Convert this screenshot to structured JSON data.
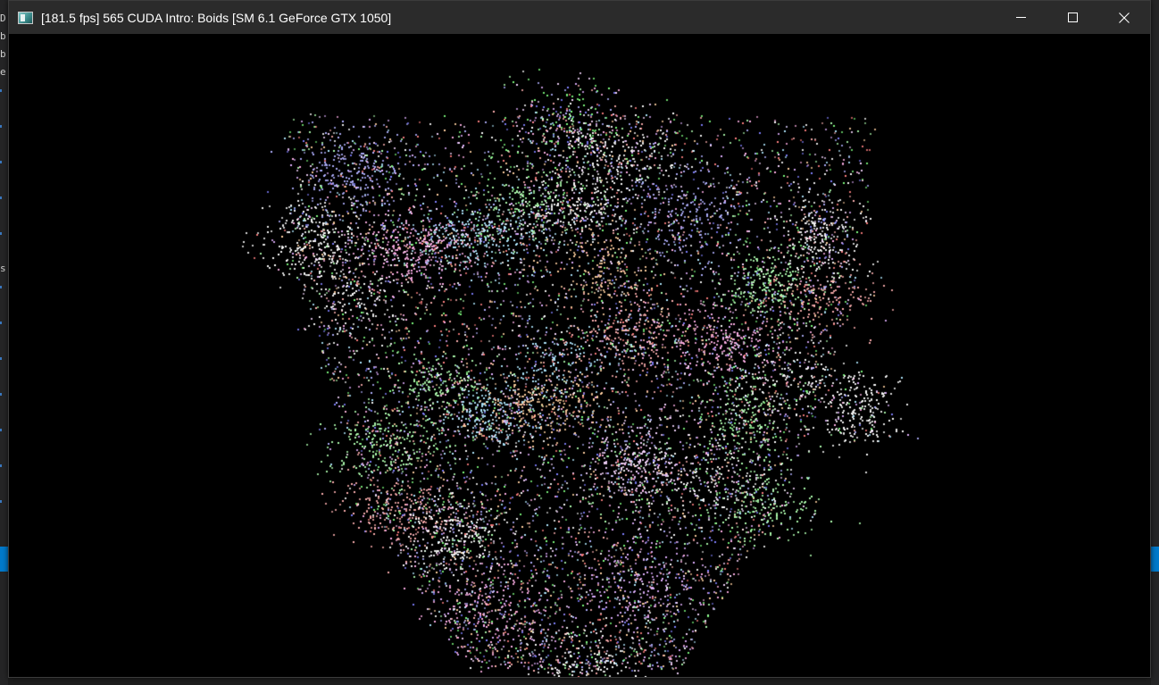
{
  "window": {
    "title": "[181.5 fps] 565 CUDA Intro: Boids [SM 6.1 GeForce GTX 1050]",
    "controls": {
      "minimize_icon": "minimize-icon",
      "maximize_icon": "maximize-icon",
      "close_icon": "close-icon"
    }
  },
  "background_edge": {
    "glyphs": [
      "D",
      "b",
      "b",
      "e",
      "s"
    ]
  },
  "simulation": {
    "palette": [
      "#ffffff",
      "#f6d6ff",
      "#ffb0e8",
      "#ffb0b0",
      "#b0ffb0",
      "#b0e8ff",
      "#b0b0ff",
      "#e0b0ff",
      "#ffd0a0",
      "#ff8080",
      "#80ff80",
      "#8080ff"
    ],
    "background": "#000000",
    "accent": "#007acc"
  }
}
